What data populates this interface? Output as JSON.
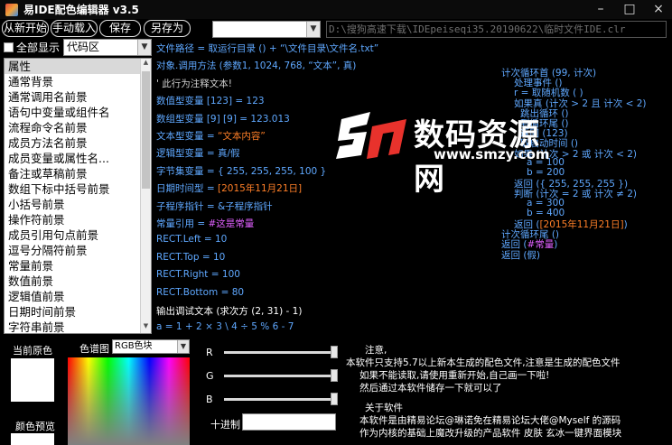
{
  "window": {
    "title": "易IDE配色编辑器 v3.5",
    "controls": [
      "minimize-icon",
      "maximize-icon",
      "close-icon"
    ]
  },
  "toolbar": {
    "reload_label": "从新开始",
    "manual_load_label": "手动载入",
    "save_label": "保存",
    "save_as_label": "另存为",
    "color_select_value": "",
    "path_value": "D:\\搜狗高速下载\\IDEpeiseqi35.20190622\\临时文件IDE.clr"
  },
  "sidebar": {
    "show_all_label": "全部显示",
    "show_all_checked": false,
    "category_value": "代码区",
    "items": [
      "属性",
      "通常背景",
      "通常调用名前景",
      "语句中变量或组件名",
      "流程命令名前景",
      "成员方法名前景",
      "成员变量或属性名...",
      "备注或草稿前景",
      "数组下标中括号前景",
      "小括号前景",
      "操作符前景",
      "成员引用句点前景",
      "逗号分隔符前景",
      "常量前景",
      "数值前景",
      "逻辑值前景",
      "日期时间前景",
      "字符串前景"
    ],
    "selected_index": 0
  },
  "code_preview": {
    "lines": [
      {
        "segments": [
          {
            "t": "文件路径 = 取运行目录 () + “\\文件目录\\文件名.txt”",
            "c": "#5fa8ff"
          }
        ]
      },
      {
        "segments": [
          {
            "t": "对象.调用方法 (参数1, 1024, 768, “文本”, 真)",
            "c": "#5fa8ff"
          }
        ]
      },
      {
        "segments": [
          {
            "t": "' 此行为注释文本!",
            "c": "#d0d0d0"
          }
        ]
      },
      {
        "segments": [
          {
            "t": "数值型变量 [123] = 123",
            "c": "#5fa8ff"
          }
        ]
      },
      {
        "segments": [
          {
            "t": "数组型变量 [9] [9] = 123.013",
            "c": "#5fa8ff"
          }
        ]
      },
      {
        "segments": [
          {
            "t": "文本型变量 = ",
            "c": "#5fa8ff"
          },
          {
            "t": "“文本内容”",
            "c": "#ff7f27"
          }
        ]
      },
      {
        "segments": [
          {
            "t": "逻辑型变量 = 真/假",
            "c": "#5fa8ff"
          }
        ]
      },
      {
        "segments": [
          {
            "t": "字节集变量 = { 255, 255, 255, 100 }",
            "c": "#5fa8ff"
          }
        ]
      },
      {
        "segments": [
          {
            "t": "日期时间型 = ",
            "c": "#5fa8ff"
          },
          {
            "t": "[2015年11月21日]",
            "c": "#ff7f27"
          }
        ]
      },
      {
        "segments": [
          {
            "t": "子程序指针 = &子程序指针",
            "c": "#5fa8ff"
          }
        ]
      },
      {
        "segments": [
          {
            "t": "常量引用 = ",
            "c": "#5fa8ff"
          },
          {
            "t": "#这是常量",
            "c": "#e060ff"
          }
        ]
      },
      {
        "segments": [
          {
            "t": "RECT.Left = 10",
            "c": "#5fa8ff"
          }
        ]
      },
      {
        "segments": [
          {
            "t": "RECT.Top = 10",
            "c": "#5fa8ff"
          }
        ]
      },
      {
        "segments": [
          {
            "t": "RECT.Right = 100",
            "c": "#5fa8ff"
          }
        ]
      },
      {
        "segments": [
          {
            "t": "RECT.Bottom = 80",
            "c": "#5fa8ff"
          }
        ]
      },
      {
        "segments": [
          {
            "t": "输出调试文本 (求次方 (2, 31) - 1)",
            "c": "#ffffff"
          }
        ]
      },
      {
        "segments": [
          {
            "t": "a = 1 + 2 × 3 \\ 4 ÷ 5 % 6 - 7",
            "c": "#5fa8ff"
          }
        ]
      }
    ],
    "right_lines": [
      {
        "indent": 0,
        "segments": [
          {
            "t": "计次循环首 (99, 计次)",
            "c": "#5fa8ff"
          }
        ]
      },
      {
        "indent": 2,
        "segments": [
          {
            "t": "处理事件 ()",
            "c": "#5fa8ff"
          }
        ]
      },
      {
        "indent": 2,
        "segments": [
          {
            "t": "r = 取随机数 ( )",
            "c": "#5fa8ff"
          }
        ]
      },
      {
        "indent": 2,
        "segments": [
          {
            "t": "如果真 (计次 > 2 且 计次 < 2)",
            "c": "#5fa8ff"
          }
        ]
      },
      {
        "indent": 3,
        "segments": [
          {
            "t": "跳出循环 ()",
            "c": "#5fa8ff"
          }
        ]
      },
      {
        "indent": 3,
        "segments": [
          {
            "t": "到循环尾 ()",
            "c": "#5fa8ff"
          }
        ]
      },
      {
        "indent": 3,
        "segments": [
          {
            "t": "返回 (123)",
            "c": "#5fa8ff"
          }
        ]
      },
      {
        "indent": 3,
        "segments": [
          {
            "t": "取启动时间 ()",
            "c": "#5fa8ff"
          }
        ]
      },
      {
        "indent": 2,
        "segments": [
          {
            "t": "如果 (计次 > 2 或 计次 < 2)",
            "c": "#5fa8ff"
          }
        ]
      },
      {
        "indent": 4,
        "segments": [
          {
            "t": "a = 100",
            "c": "#5fa8ff"
          }
        ]
      },
      {
        "indent": 4,
        "segments": [
          {
            "t": "b = 200",
            "c": "#5fa8ff"
          }
        ]
      },
      {
        "indent": 2,
        "segments": [
          {
            "t": "返回 ({ 255, 255, 255 })",
            "c": "#5fa8ff"
          }
        ]
      },
      {
        "indent": 2,
        "segments": [
          {
            "t": "判断 (计次 = 2 或 计次 ≠ 2)",
            "c": "#5fa8ff"
          }
        ]
      },
      {
        "indent": 4,
        "segments": [
          {
            "t": "a = 300",
            "c": "#5fa8ff"
          }
        ]
      },
      {
        "indent": 4,
        "segments": [
          {
            "t": "b = 400",
            "c": "#5fa8ff"
          }
        ]
      },
      {
        "indent": 2,
        "segments": [
          {
            "t": "返回 (",
            "c": "#5fa8ff"
          },
          {
            "t": "[2015年11月21日]",
            "c": "#ff7f27"
          },
          {
            "t": ")",
            "c": "#5fa8ff"
          }
        ]
      },
      {
        "indent": 0,
        "segments": [
          {
            "t": "计次循环尾 ()",
            "c": "#5fa8ff"
          }
        ]
      },
      {
        "indent": 0,
        "segments": [
          {
            "t": "返回 (",
            "c": "#5fa8ff"
          },
          {
            "t": "#常量",
            "c": "#e060ff"
          },
          {
            "t": ")",
            "c": "#5fa8ff"
          }
        ]
      },
      {
        "indent": 0,
        "segments": [
          {
            "t": "返回 (假)",
            "c": "#5fa8ff"
          }
        ]
      }
    ]
  },
  "watermark": {
    "title": "数码资源网",
    "url": "www.smzy.com",
    "colors": {
      "logo_red": "#e8322c",
      "logo_white": "#ffffff"
    }
  },
  "color_panel": {
    "current_color_label": "当前原色",
    "preview_label": "颜色预览",
    "palette_label": "色谱图",
    "palette_mode": "RGB色块",
    "r_label": "R",
    "g_label": "G",
    "b_label": "B",
    "hex_label": "十进制",
    "hex_value": "",
    "r_value": 255,
    "g_value": 255,
    "b_value": 255
  },
  "notes": {
    "lines": [
      "注意,",
      "本软件只支持5.7以上新本生成的配色文件,注意是生成的配色文件",
      "如果不能读取,请使用重新开始,自己画一下啦!",
      "然后通过本软件储存一下就可以了",
      "关于软件",
      "本软件是由精易论坛@琳诺免在精易论坛大佬@Myself 的源码",
      "作为内核的基础上魔改升级的产品软件    皮肤 玄冰一键界面模块"
    ]
  },
  "colors": {
    "background": "#000000",
    "keyword_blue": "#5fa8ff",
    "string_orange": "#ff7f27",
    "constant_purple": "#e060ff"
  }
}
